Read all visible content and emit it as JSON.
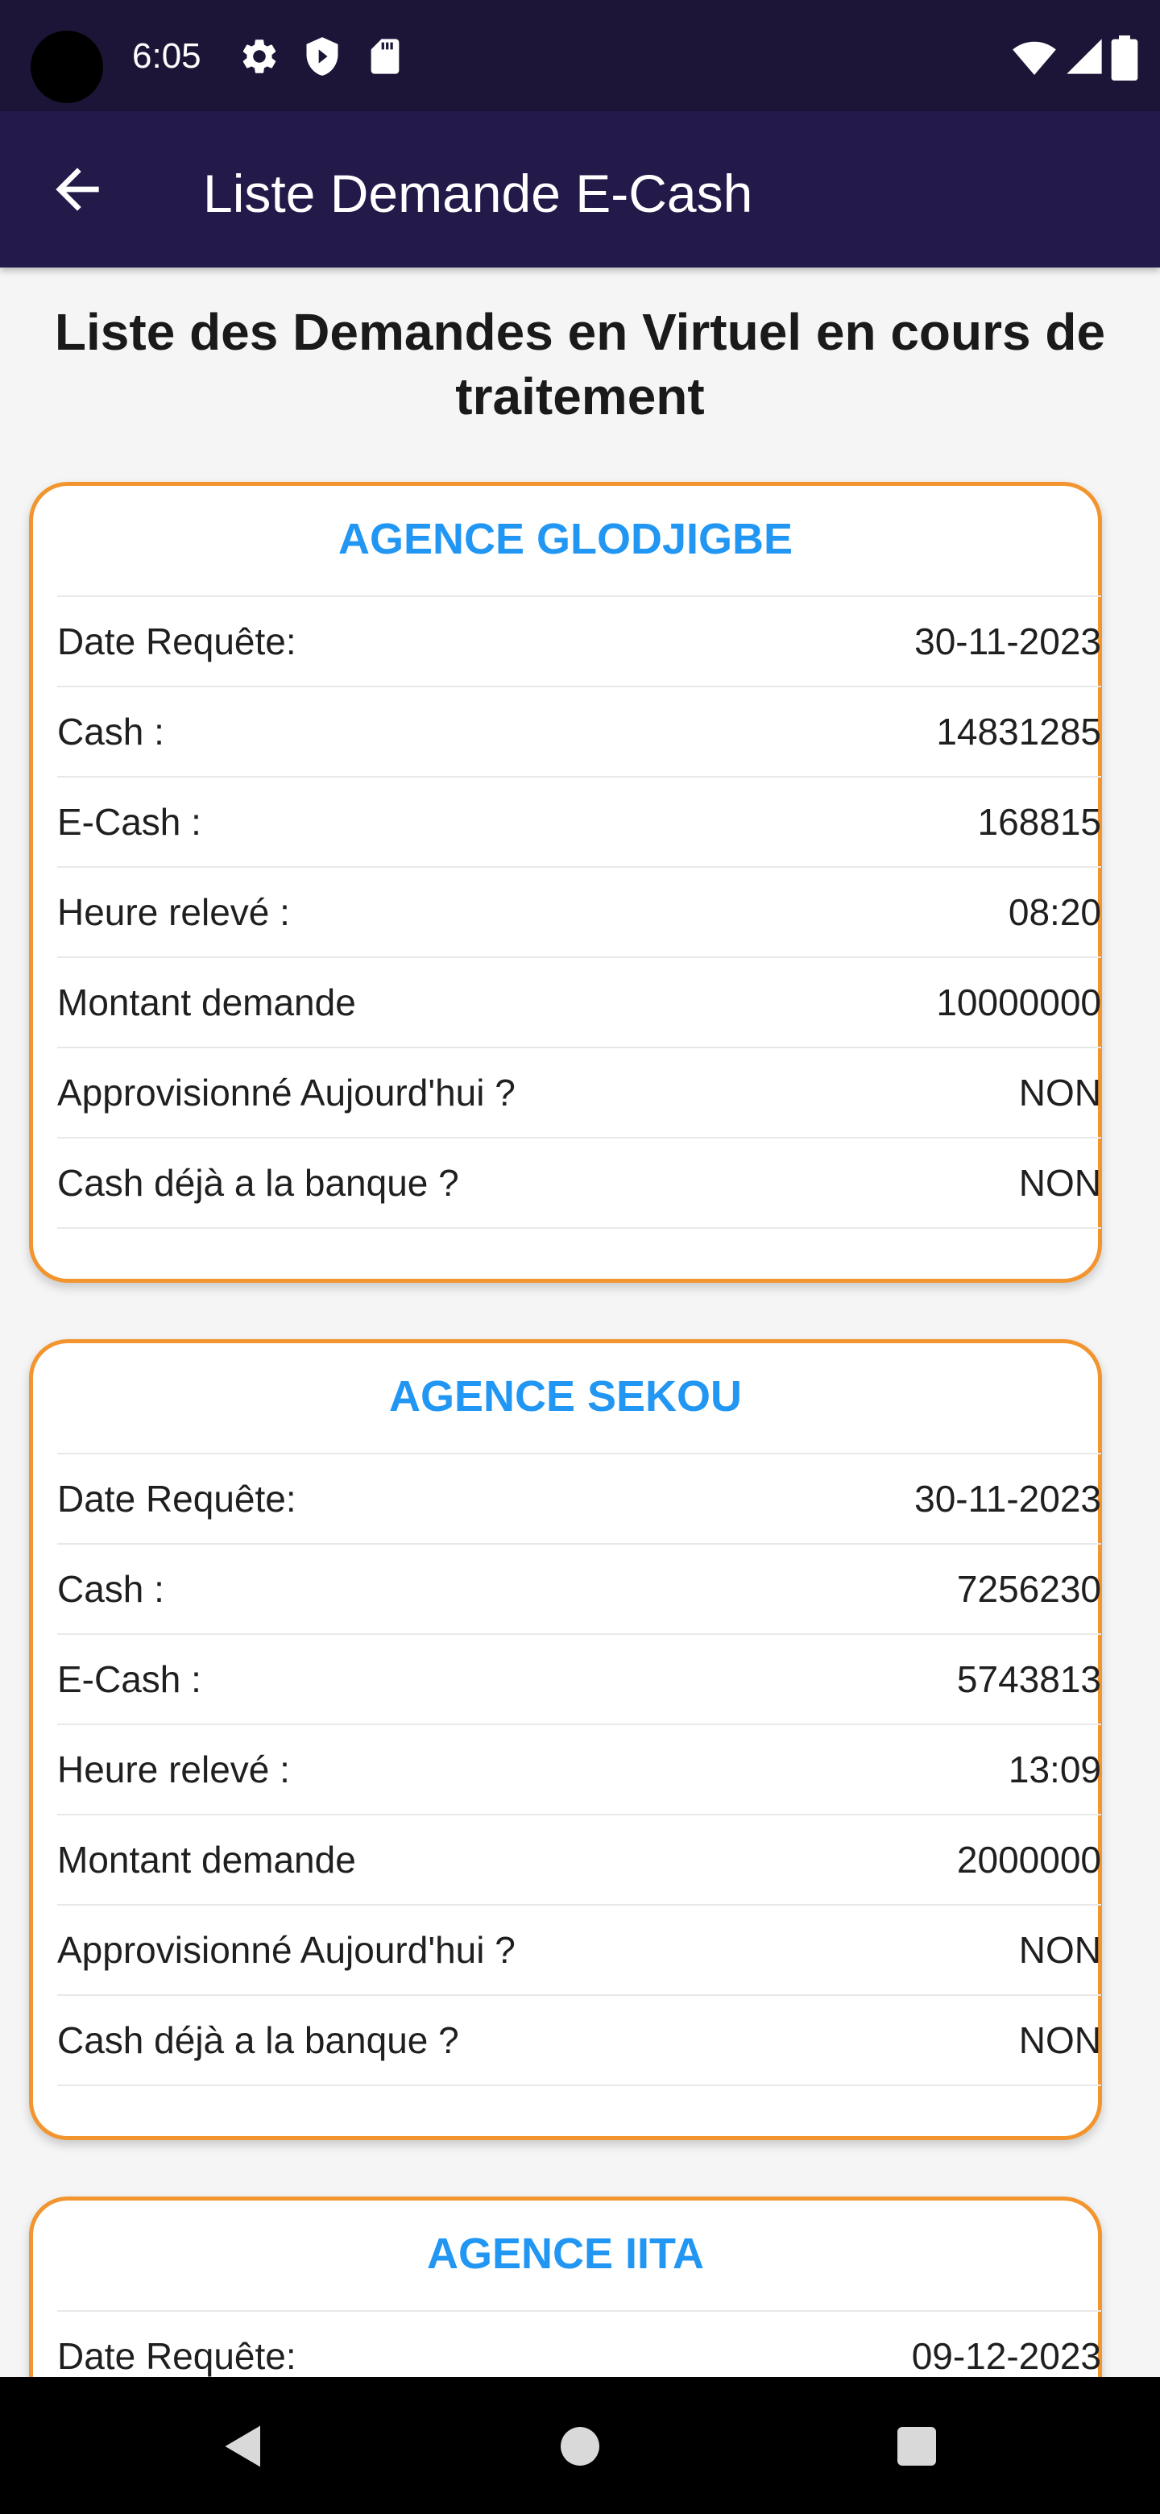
{
  "status_bar": {
    "time": "6:05",
    "icons_left": [
      "gear-icon",
      "shield-icon",
      "sd-card-icon"
    ],
    "icons_right": [
      "wifi-icon",
      "signal-icon",
      "battery-icon"
    ]
  },
  "app_bar": {
    "title": "Liste Demande E-Cash",
    "back_icon": "arrow-left-icon"
  },
  "page": {
    "heading": "Liste des Demandes en Virtuel en cours de traitement"
  },
  "cards": [
    {
      "title": "AGENCE GLODJIGBE",
      "rows": [
        {
          "label": "Date Requête:",
          "value": "30-11-2023"
        },
        {
          "label": "Cash :",
          "value": "14831285"
        },
        {
          "label": "E-Cash :",
          "value": "168815"
        },
        {
          "label": "Heure relevé :",
          "value": "08:20"
        },
        {
          "label": "Montant demande",
          "value": "10000000"
        },
        {
          "label": "Approvisionné Aujourd'hui ?",
          "value": "NON"
        },
        {
          "label": "Cash déjà a la banque ?",
          "value": "NON"
        }
      ]
    },
    {
      "title": "AGENCE SEKOU",
      "rows": [
        {
          "label": "Date Requête:",
          "value": "30-11-2023"
        },
        {
          "label": "Cash :",
          "value": "7256230"
        },
        {
          "label": "E-Cash :",
          "value": "5743813"
        },
        {
          "label": "Heure relevé :",
          "value": "13:09"
        },
        {
          "label": "Montant demande",
          "value": "2000000"
        },
        {
          "label": "Approvisionné Aujourd'hui ?",
          "value": "NON"
        },
        {
          "label": "Cash déjà a la banque ?",
          "value": "NON"
        }
      ]
    },
    {
      "title": "AGENCE IITA",
      "rows": [
        {
          "label": "Date Requête:",
          "value": "09-12-2023"
        }
      ]
    }
  ],
  "nav_bar": {
    "icons": [
      "back-triangle-icon",
      "home-circle-icon",
      "recents-square-icon"
    ]
  },
  "colors": {
    "status_bar_bg": "#1c1537",
    "app_bar_bg": "#241a4a",
    "card_border": "#f2952e",
    "card_title": "#2196f3"
  }
}
